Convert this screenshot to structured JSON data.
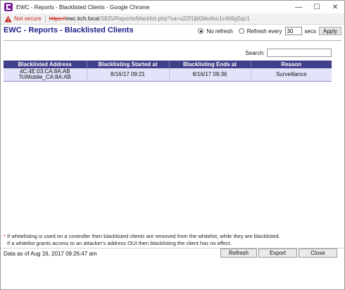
{
  "window": {
    "title": "EWC - Reports - Blacklisted Clients - Google Chrome",
    "controls": {
      "minimize": "—",
      "maximize": "☐",
      "close": "✕"
    }
  },
  "addressbar": {
    "security_label": "Not secure",
    "url_scheme": "https://",
    "url_host": "ewc.kch.local",
    "url_rest": ":5825/Reports/blacklist.php?sa=u22f1ljti0bksfoo1c466g5qc1"
  },
  "header": {
    "title": "EWC - Reports - Blacklisted Clients",
    "no_refresh_label": "No refresh",
    "refresh_every_label": "Refresh every",
    "refresh_seconds": "30",
    "secs_label": "secs",
    "apply_label": "Apply",
    "selected_mode": "no_refresh"
  },
  "search": {
    "label": "Search:",
    "value": ""
  },
  "table": {
    "columns": [
      "Blacklisted Address",
      "Blacklisting Started at",
      "Blacklisting Ends at",
      "Reason"
    ],
    "rows": [
      {
        "address_line1": "4C:4E:03:CA:8A:AB",
        "address_line2": "TctMobile_CA:8A:AB",
        "started": "8/16/17 09:21",
        "ends": "8/16/17 09:36",
        "reason": "Surveillance"
      }
    ]
  },
  "footnote": {
    "star": "*",
    "line1": " If whitelisting is used on a controller then blacklisted clients are removed from the whitelist, while they are blacklisted.",
    "line2": "If a whitelist grants access to an attacker's address OUI then blacklisting the client has no effect."
  },
  "footer": {
    "data_as_of": "Data as of Aug 16, 2017 09:26:47 am",
    "refresh_label": "Refresh",
    "export_label": "Export",
    "close_label": "Close"
  },
  "colors": {
    "title_blue": "#1f1f8a",
    "table_header": "#403f8a",
    "table_row": "#e3e3f9",
    "not_secure_red": "#c5221f"
  }
}
